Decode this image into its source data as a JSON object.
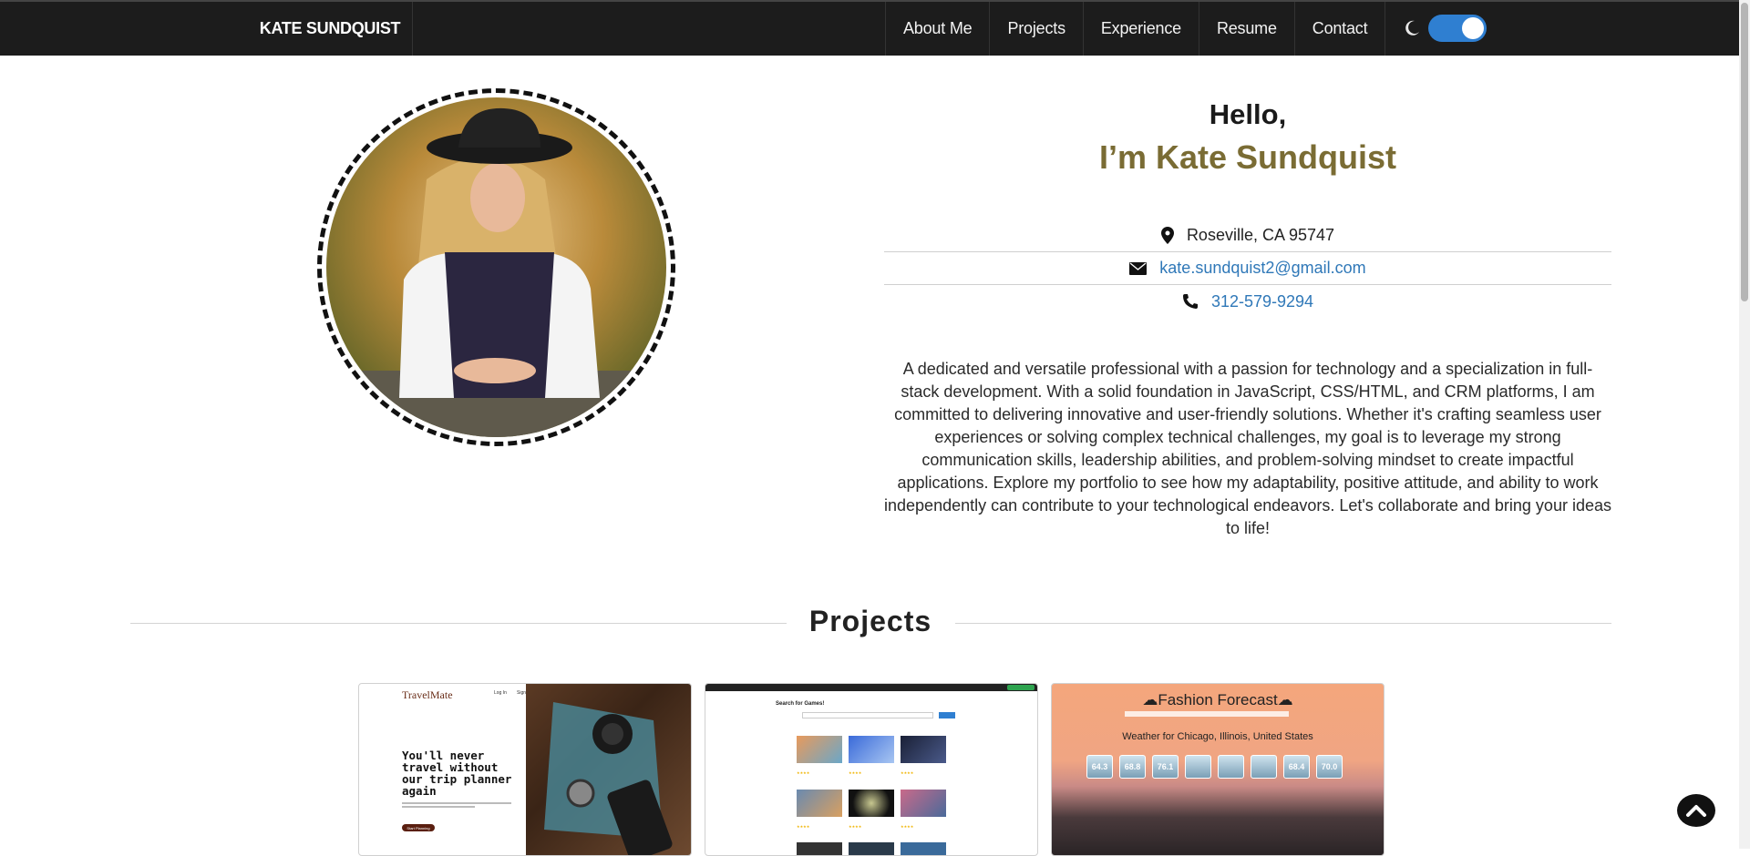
{
  "nav": {
    "brand": "KATE SUNDQUIST",
    "links": [
      "About Me",
      "Projects",
      "Experience",
      "Resume",
      "Contact"
    ],
    "theme_toggle": "dark-mode-toggle",
    "theme_icon": "moon-icon",
    "toggle_color": "#2f7fd1"
  },
  "hero": {
    "greeting": "Hello,",
    "name": "I’m Kate Sundquist",
    "name_color": "#7a6c34",
    "location": "Roseville, CA 95747",
    "email": "kate.sundquist2@gmail.com",
    "phone": "312-579-9294",
    "bio": "A dedicated and versatile professional with a passion for technology and a specialization in full-stack development. With a solid foundation in JavaScript, CSS/HTML, and CRM platforms, I am committed to delivering innovative and user-friendly solutions. Whether it's crafting seamless user experiences or solving complex technical challenges, my goal is to leverage my strong communication skills, leadership abilities, and problem-solving mindset to create impactful applications. Explore my portfolio to see how my adaptability, positive attitude, and ability to work independently can contribute to your technological endeavors. Let's collaborate and bring your ideas to life!"
  },
  "projects": {
    "title": "Projects",
    "cards": [
      {
        "logo": "TravelMate",
        "nav_login": "Log In",
        "nav_signup": "Sign Up",
        "headline": "You'll never travel without our trip planner again",
        "button": "Start Planning"
      },
      {
        "title": "Search for Games!"
      },
      {
        "title": "Fashion Forecast",
        "subtitle": "Weather for Chicago, Illinois, United States",
        "temps": [
          "64.3",
          "68.8",
          "76.1",
          "",
          "",
          "",
          "68.4",
          "70.0"
        ]
      }
    ]
  },
  "icons": {
    "location": "map-marker-icon",
    "email": "envelope-icon",
    "phone": "phone-icon",
    "back_to_top": "chevron-up-icon"
  }
}
